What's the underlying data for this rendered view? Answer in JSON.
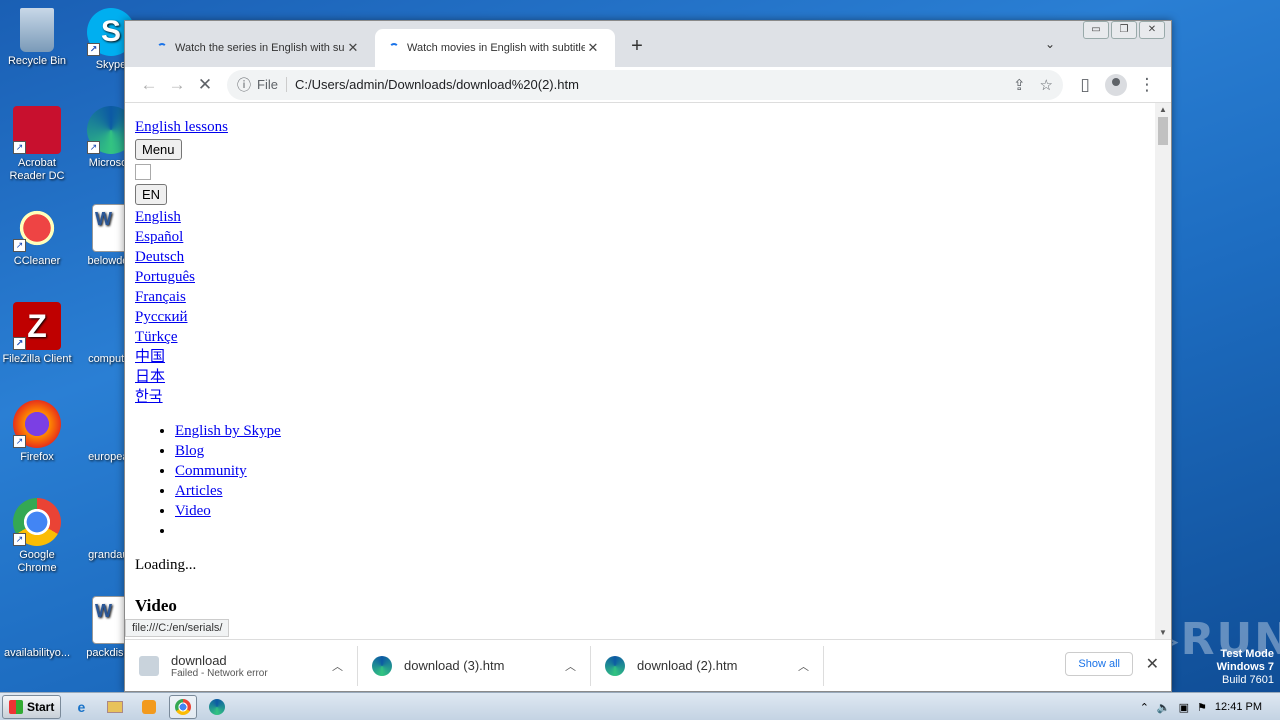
{
  "desktop": {
    "icons": [
      {
        "label": "Recycle Bin"
      },
      {
        "label": "Skype"
      },
      {
        "label": "Acrobat Reader DC"
      },
      {
        "label": "Microsoft"
      },
      {
        "label": "CCleaner"
      },
      {
        "label": "belowdea"
      },
      {
        "label": "FileZilla Client"
      },
      {
        "label": "computer"
      },
      {
        "label": "Firefox"
      },
      {
        "label": "europeac"
      },
      {
        "label": "Google Chrome"
      },
      {
        "label": "grandaus"
      },
      {
        "label": "availabilityo..."
      },
      {
        "label": "packdisea"
      }
    ],
    "watermark": "ANY▷RUN",
    "test_mode": {
      "line1": "Test Mode",
      "line2": "Windows 7",
      "line3": "Build 7601"
    }
  },
  "browser": {
    "tabs": [
      {
        "title": "Watch the series in English with subt",
        "close": "✕"
      },
      {
        "title": "Watch movies in English with subtitle",
        "close": "✕"
      }
    ],
    "new_tab": "+",
    "tab_dropdown": "⌄",
    "window_controls": {
      "minimize": "▭",
      "restore": "❐",
      "close": "✕"
    },
    "toolbar": {
      "back": "←",
      "forward": "→",
      "stop": "✕",
      "info_icon": "ⓘ",
      "scheme": "File",
      "url": "C:/Users/admin/Downloads/download%20(2).htm",
      "share": "⇪",
      "bookmark": "☆",
      "sidepanel": "▯",
      "menu": "⋮"
    },
    "page": {
      "english_lessons": "English lessons",
      "menu_button": "Menu",
      "lang_button": "EN",
      "languages": [
        "English",
        "Español",
        "Deutsch",
        "Português",
        "Français",
        "Русский",
        "Türkçe",
        "中国",
        "日本",
        "한국"
      ],
      "nav": [
        "English by Skype",
        "Blog",
        "Community",
        "Articles",
        "Video",
        ""
      ],
      "loading": "Loading...",
      "heading": "Video"
    },
    "status_url": "file:///C:/en/serials/",
    "downloads": [
      {
        "name": "download",
        "sub": "Failed - Network error"
      },
      {
        "name": "download (3).htm",
        "sub": ""
      },
      {
        "name": "download (2).htm",
        "sub": ""
      }
    ],
    "show_all": "Show all",
    "downloads_close": "✕"
  },
  "taskbar": {
    "start": "Start",
    "clock": "12:41 PM"
  }
}
